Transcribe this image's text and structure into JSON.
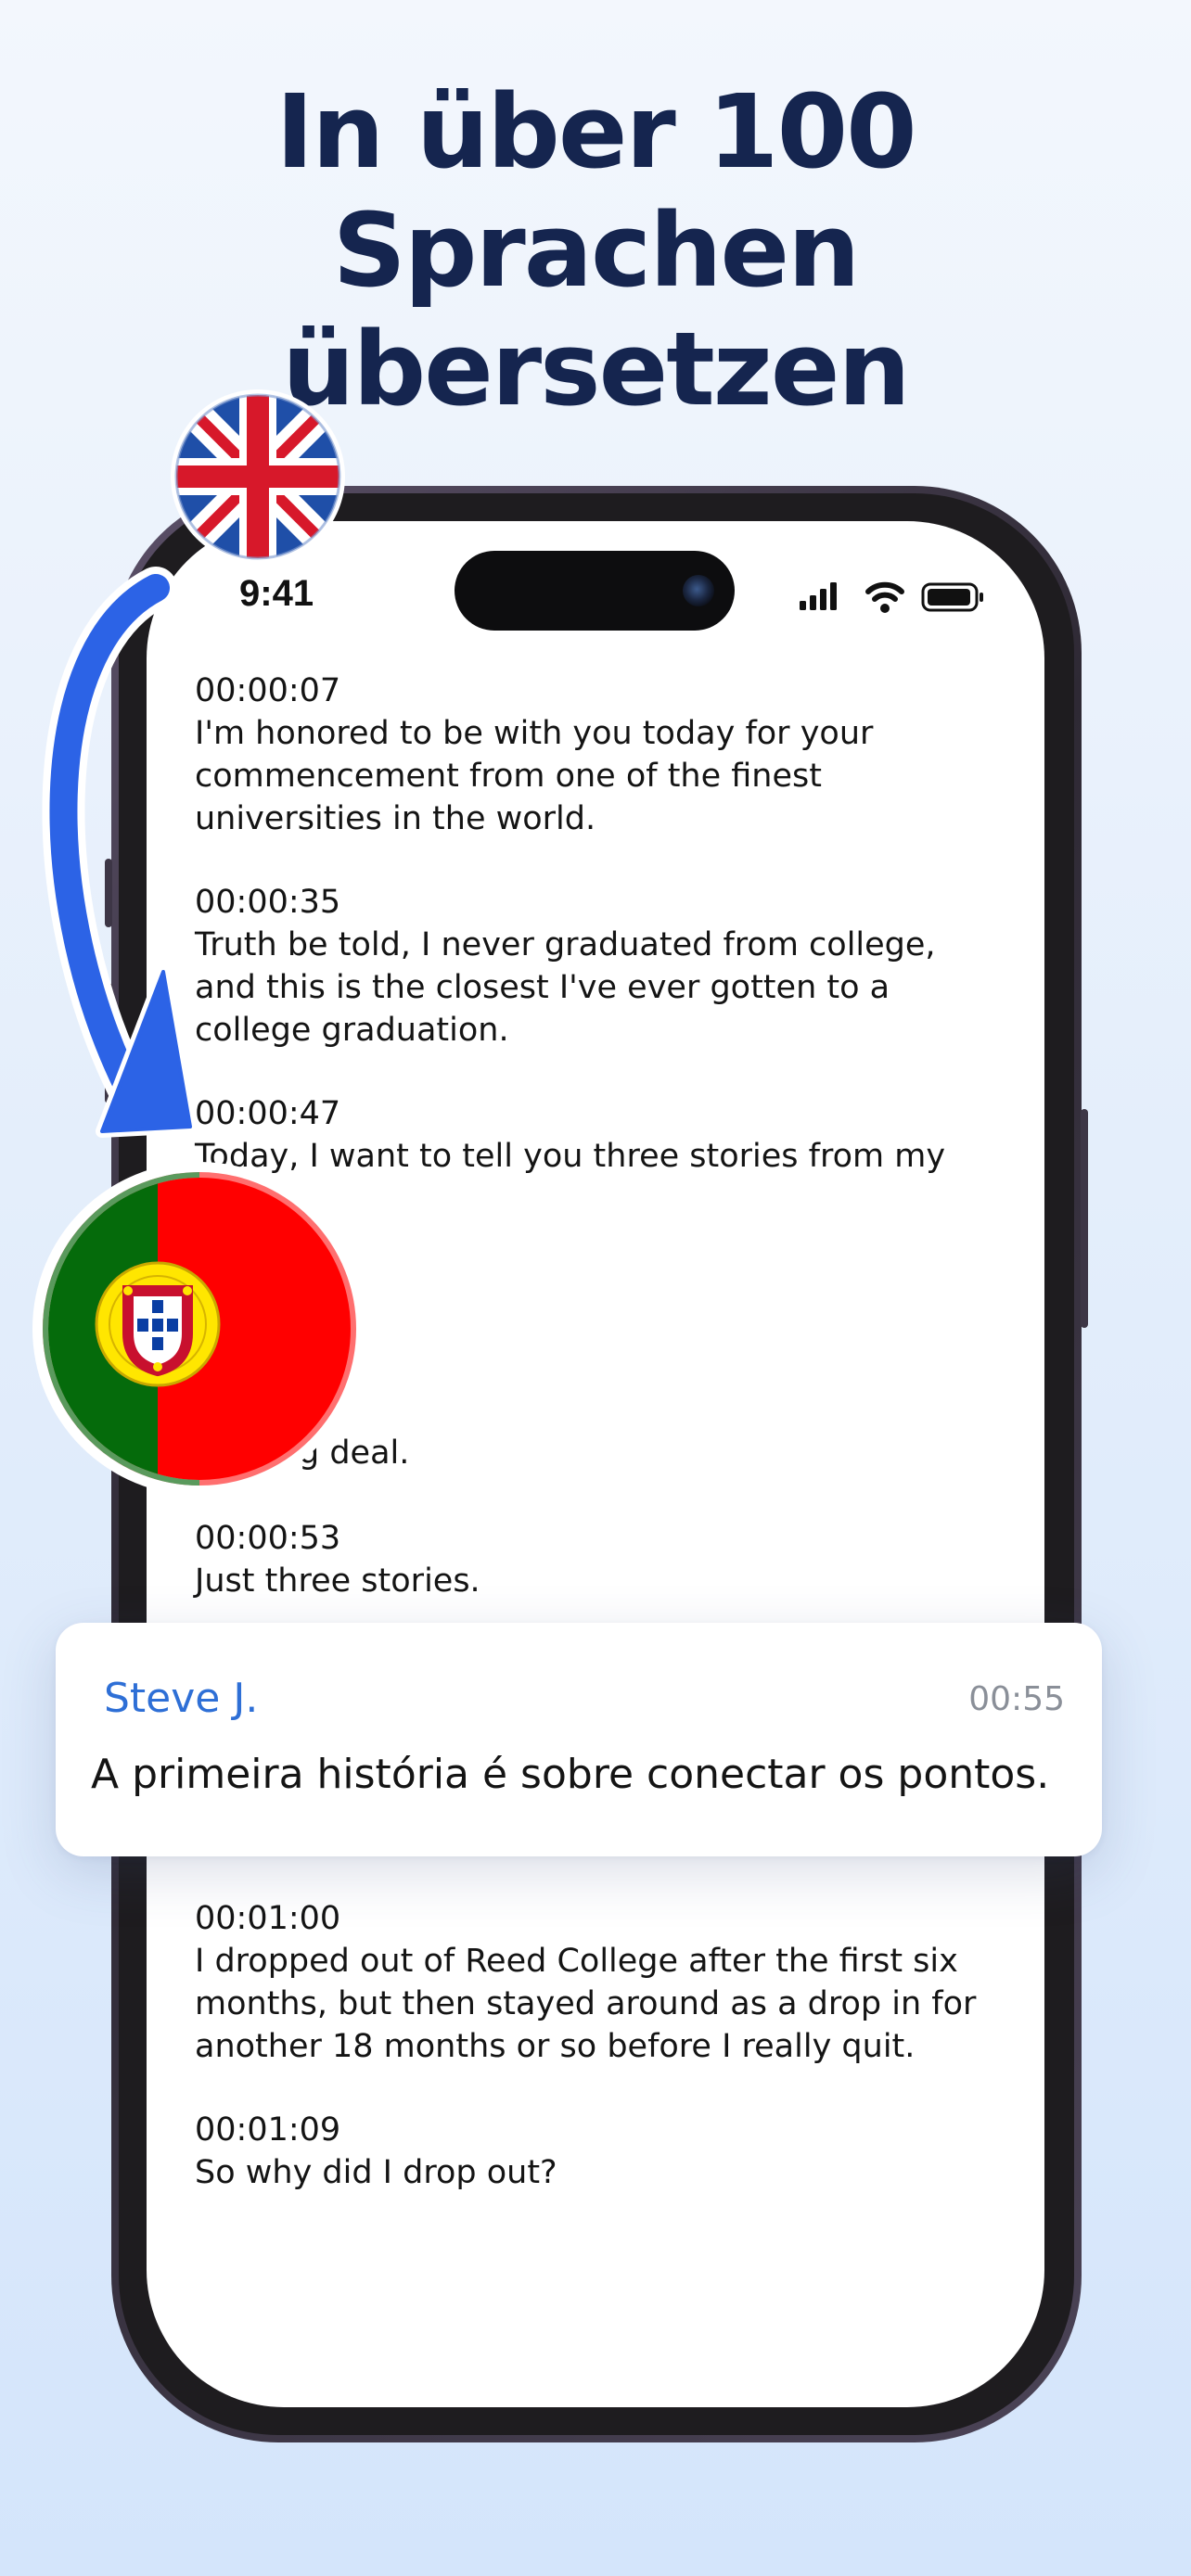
{
  "headline": {
    "line1": "In über 100",
    "line2": "Sprachen",
    "line3": "übersetzen"
  },
  "status_bar": {
    "time": "9:41"
  },
  "transcript": [
    {
      "timestamp": "00:00:07",
      "lines": [
        "I'm honored to be with you today for your",
        "commencement from one of the finest",
        "universities in the world."
      ]
    },
    {
      "timestamp": "00:00:35",
      "lines": [
        "Truth be told, I never graduated from college,",
        "and this is the closest I've ever gotten to a",
        "college graduation."
      ]
    },
    {
      "timestamp": "00:00:47",
      "lines": [
        "Today, I want to tell you three stories from my"
      ]
    },
    {
      "timestamp": "",
      "lines": [
        "g deal."
      ]
    },
    {
      "timestamp": "00:00:53",
      "lines": [
        "Just three stories."
      ]
    },
    {
      "timestamp": "00:01:00",
      "lines": [
        "I dropped out of Reed College after the first six",
        "months, but then stayed around as a drop in for",
        "another 18 months or so before I really quit."
      ]
    },
    {
      "timestamp": "00:01:09",
      "lines": [
        "So why did I drop out?"
      ]
    }
  ],
  "popup": {
    "speaker": "Steve J.",
    "time": "00:55",
    "text": "A primeira história é sobre conectar os pontos."
  },
  "colors": {
    "headline": "#15254f",
    "accent_blue": "#2e6fd6",
    "arrow_blue": "#2c63e6"
  },
  "icons": [
    "uk-flag-icon",
    "portugal-flag-icon",
    "curved-arrow-icon",
    "signal-icon",
    "wifi-icon",
    "battery-icon"
  ]
}
